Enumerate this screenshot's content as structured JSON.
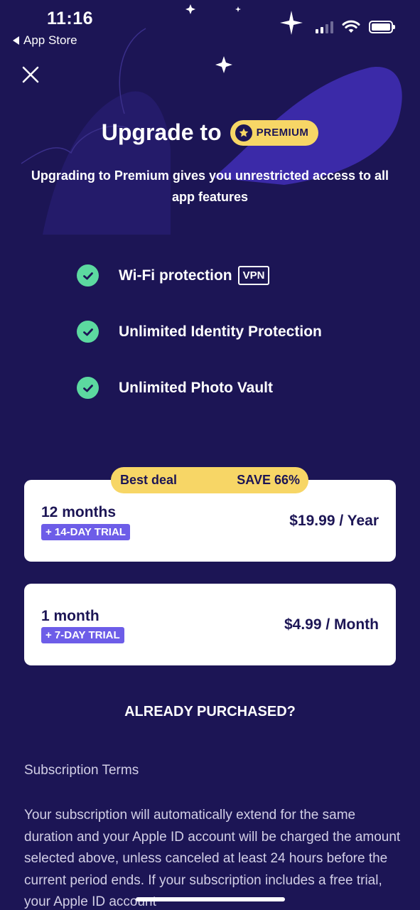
{
  "status_bar": {
    "time": "11:16",
    "back_label": "App Store"
  },
  "header": {
    "title": "Upgrade to",
    "badge": "PREMIUM",
    "subtitle": "Upgrading to Premium gives you unrestricted access to all app features"
  },
  "features": [
    {
      "label": "Wi-Fi protection",
      "tag": "VPN"
    },
    {
      "label": "Unlimited Identity Protection"
    },
    {
      "label": "Unlimited Photo Vault"
    }
  ],
  "deal_banner": {
    "left": "Best deal",
    "right": "SAVE 66%"
  },
  "plans": [
    {
      "name": "12 months",
      "trial": "+ 14-DAY TRIAL",
      "price": "$19.99 / Year"
    },
    {
      "name": "1 month",
      "trial": "+ 7-DAY TRIAL",
      "price": "$4.99 / Month"
    }
  ],
  "already_purchased": "ALREADY PURCHASED?",
  "terms": {
    "heading": "Subscription Terms",
    "body": "Your subscription will automatically extend for the same duration and your Apple ID account will be charged the amount selected above, unless canceled at least 24 hours before the current period ends. If your subscription includes a free trial, your Apple ID account"
  },
  "colors": {
    "background": "#1c1555",
    "accent_yellow": "#f7d666",
    "check_green": "#5cd9a0",
    "trial_purple": "#6d5de8"
  }
}
